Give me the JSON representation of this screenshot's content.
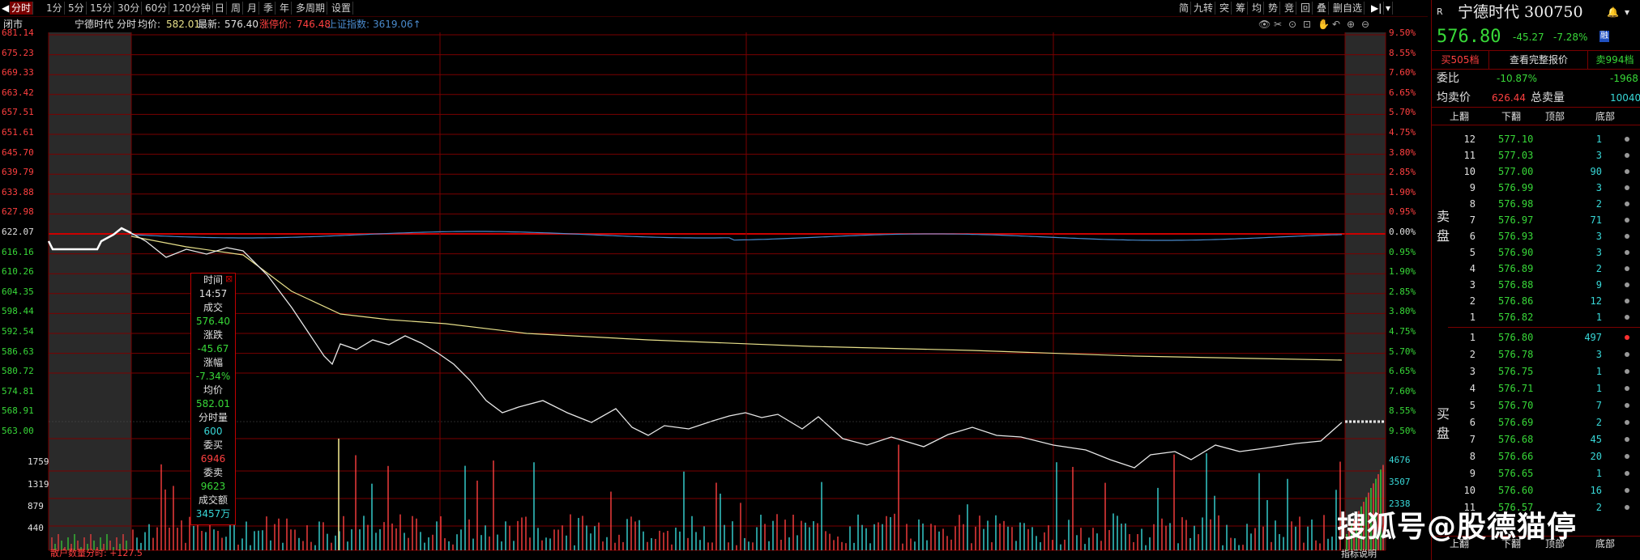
{
  "toolbar": {
    "left_items": [
      "分时",
      "1分",
      "5分",
      "15分",
      "30分",
      "60分",
      "120分钟",
      "日",
      "周",
      "月",
      "季",
      "年",
      "多周期",
      "设置"
    ],
    "right_items": [
      "简",
      "九转",
      "突",
      "筹",
      "均",
      "势",
      "竞",
      "回",
      "叠",
      "删自选"
    ]
  },
  "infobar": {
    "status": "闭市",
    "stock": "宁德时代",
    "mode": "分时",
    "avg_label": "均价:",
    "avg_value": "582.01",
    "last_label": "最新:",
    "last_value": "576.40",
    "limit_label": "涨停价:",
    "limit_value": "746.48",
    "index_label": "上证指数:",
    "index_value": "3619.06↑"
  },
  "colors": {
    "up": "#ff4040",
    "down": "#38d838",
    "price_line": "#e8e8e8",
    "avg_line": "#e8e08a",
    "index_line": "#4a8acc",
    "grid": "#7a0000"
  },
  "left_axis": [
    "681.14",
    "675.23",
    "669.33",
    "663.42",
    "657.51",
    "651.61",
    "645.70",
    "639.79",
    "633.88",
    "627.98",
    "622.07",
    "616.16",
    "610.26",
    "604.35",
    "598.44",
    "592.54",
    "586.63",
    "580.72",
    "574.81",
    "568.91",
    "563.00"
  ],
  "right_axis": [
    "9.50%",
    "8.55%",
    "7.60%",
    "6.65%",
    "5.70%",
    "4.75%",
    "3.80%",
    "2.85%",
    "1.90%",
    "0.95%",
    "0.00%",
    "0.95%",
    "1.90%",
    "2.85%",
    "3.80%",
    "4.75%",
    "5.70%",
    "6.65%",
    "7.60%",
    "8.55%",
    "9.50%"
  ],
  "vol_axis_left": [
    "1759",
    "1319",
    "879",
    "440"
  ],
  "vol_axis_right": [
    "4676",
    "3507",
    "2338"
  ],
  "bottom_label": "散户数量分时: +127.5",
  "bottom_right_label": "指标说明",
  "tooltip": {
    "time_k": "时间",
    "time_v": "14:57",
    "deal_k": "成交",
    "deal_v": "576.40",
    "chg_k": "涨跌",
    "chg_v": "-45.67",
    "pct_k": "涨幅",
    "pct_v": "-7.34%",
    "avg_k": "均价",
    "avg_v": "582.01",
    "vol_k": "分时量",
    "vol_v": "600",
    "bid_k": "委买",
    "bid_v": "6946",
    "ask_k": "委卖",
    "ask_v": "9623",
    "amt_k": "成交额",
    "amt_v": "3457万"
  },
  "panel": {
    "tag": "R",
    "title": "宁德时代 300750",
    "price": "576.80",
    "change": "-45.27",
    "pct": "-7.28%",
    "rong": "融",
    "btn_buy": "买505档",
    "btn_full": "查看完整报价",
    "btn_sell": "卖994档",
    "weibi_k": "委比",
    "weibi_v": "-10.87%",
    "weibi_r": "-1968",
    "jmj_k": "均卖价",
    "jmj_v": "626.44",
    "zml_k": "总卖量",
    "zml_v": "10040",
    "nav": [
      "上翻",
      "下翻",
      "顶部",
      "底部"
    ],
    "sell_label": "卖盘",
    "buy_label": "买盘"
  },
  "sell_book": [
    {
      "i": "12",
      "p": "577.10",
      "v": "1"
    },
    {
      "i": "11",
      "p": "577.03",
      "v": "3"
    },
    {
      "i": "10",
      "p": "577.00",
      "v": "90"
    },
    {
      "i": "9",
      "p": "576.99",
      "v": "3"
    },
    {
      "i": "8",
      "p": "576.98",
      "v": "2"
    },
    {
      "i": "7",
      "p": "576.97",
      "v": "71"
    },
    {
      "i": "6",
      "p": "576.93",
      "v": "3"
    },
    {
      "i": "5",
      "p": "576.90",
      "v": "3"
    },
    {
      "i": "4",
      "p": "576.89",
      "v": "2"
    },
    {
      "i": "3",
      "p": "576.88",
      "v": "9"
    },
    {
      "i": "2",
      "p": "576.86",
      "v": "12"
    },
    {
      "i": "1",
      "p": "576.82",
      "v": "1"
    }
  ],
  "buy_book": [
    {
      "i": "1",
      "p": "576.80",
      "v": "497"
    },
    {
      "i": "2",
      "p": "576.78",
      "v": "3"
    },
    {
      "i": "3",
      "p": "576.75",
      "v": "1"
    },
    {
      "i": "4",
      "p": "576.71",
      "v": "1"
    },
    {
      "i": "5",
      "p": "576.70",
      "v": "7"
    },
    {
      "i": "6",
      "p": "576.69",
      "v": "2"
    },
    {
      "i": "7",
      "p": "576.68",
      "v": "45"
    },
    {
      "i": "8",
      "p": "576.66",
      "v": "20"
    },
    {
      "i": "9",
      "p": "576.65",
      "v": "1"
    },
    {
      "i": "10",
      "p": "576.60",
      "v": "16"
    },
    {
      "i": "11",
      "p": "576.57",
      "v": "2"
    }
  ],
  "watermark": "搜狐号@股德猫停"
}
